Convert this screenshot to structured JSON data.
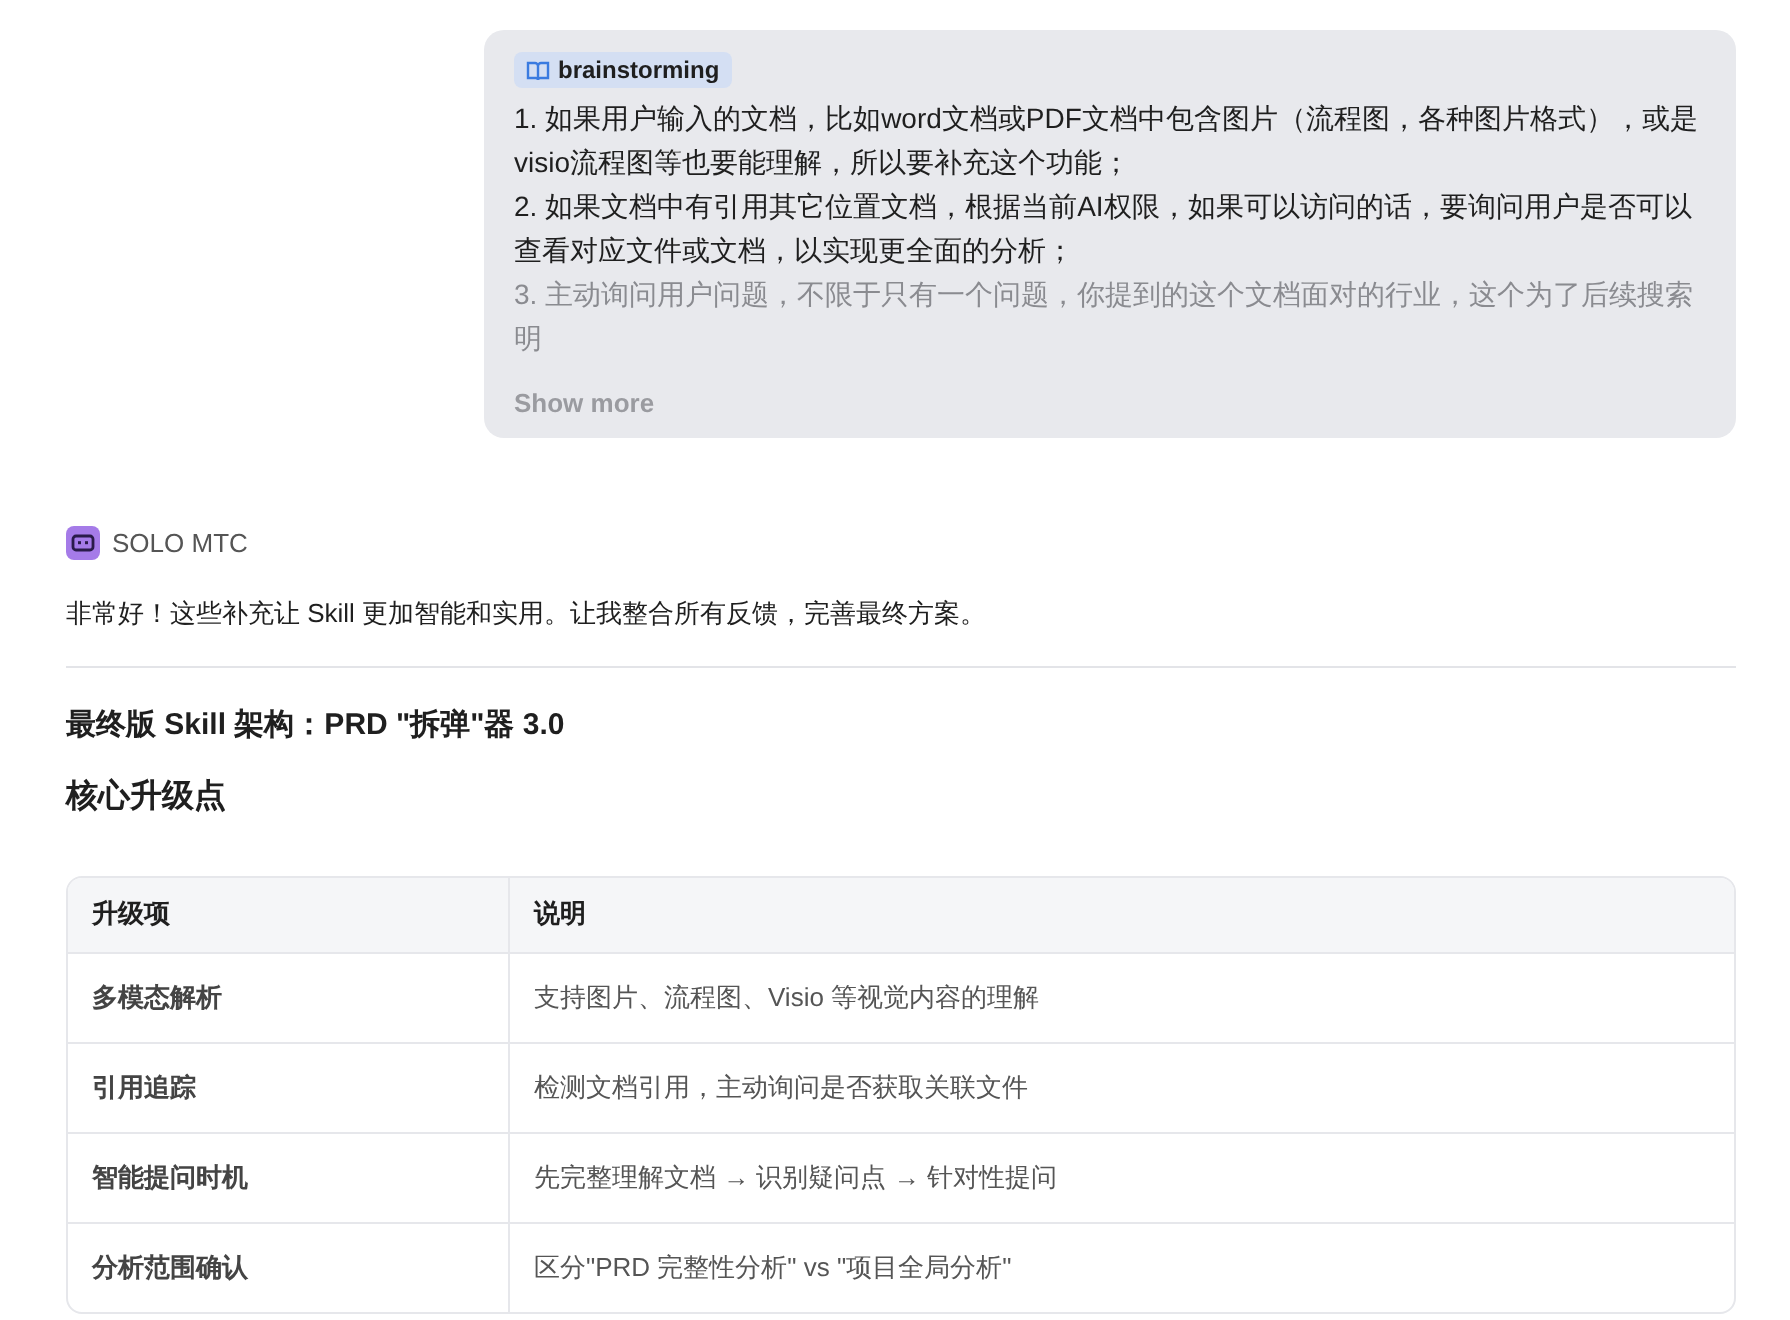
{
  "user_message": {
    "tag": "brainstorming",
    "items": [
      "1. 如果用户输入的文档，比如word文档或PDF文档中包含图片（流程图，各种图片格式），或是visio流程图等也要能理解，所以要补充这个功能；",
      "2. 如果文档中有引用其它位置文档，根据当前AI权限，如果可以访问的话，要询问用户是否可以查看对应文件或文档，以实现更全面的分析；",
      "3. 主动询问用户问题，不限于只有一个问题，你提到的这个文档面对的行业，这个为了后续搜索明"
    ],
    "show_more": "Show more"
  },
  "assistant": {
    "name": "SOLO MTC",
    "intro": "非常好！这些补充让 Skill 更加智能和实用。让我整合所有反馈，完善最终方案。",
    "title": "最终版 Skill 架构：PRD \"拆弹\"器 3.0",
    "subtitle": "核心升级点",
    "table": {
      "columns": [
        "升级项",
        "说明"
      ],
      "rows": [
        [
          "多模态解析",
          "支持图片、流程图、Visio 等视觉内容的理解"
        ],
        [
          "引用追踪",
          "检测文档引用，主动询问是否获取关联文件"
        ],
        [
          "智能提问时机",
          "先完整理解文档 → 识别疑问点 → 针对性提问"
        ],
        [
          "分析范围确认",
          "区分\"PRD 完整性分析\" vs \"项目全局分析\""
        ]
      ]
    }
  }
}
